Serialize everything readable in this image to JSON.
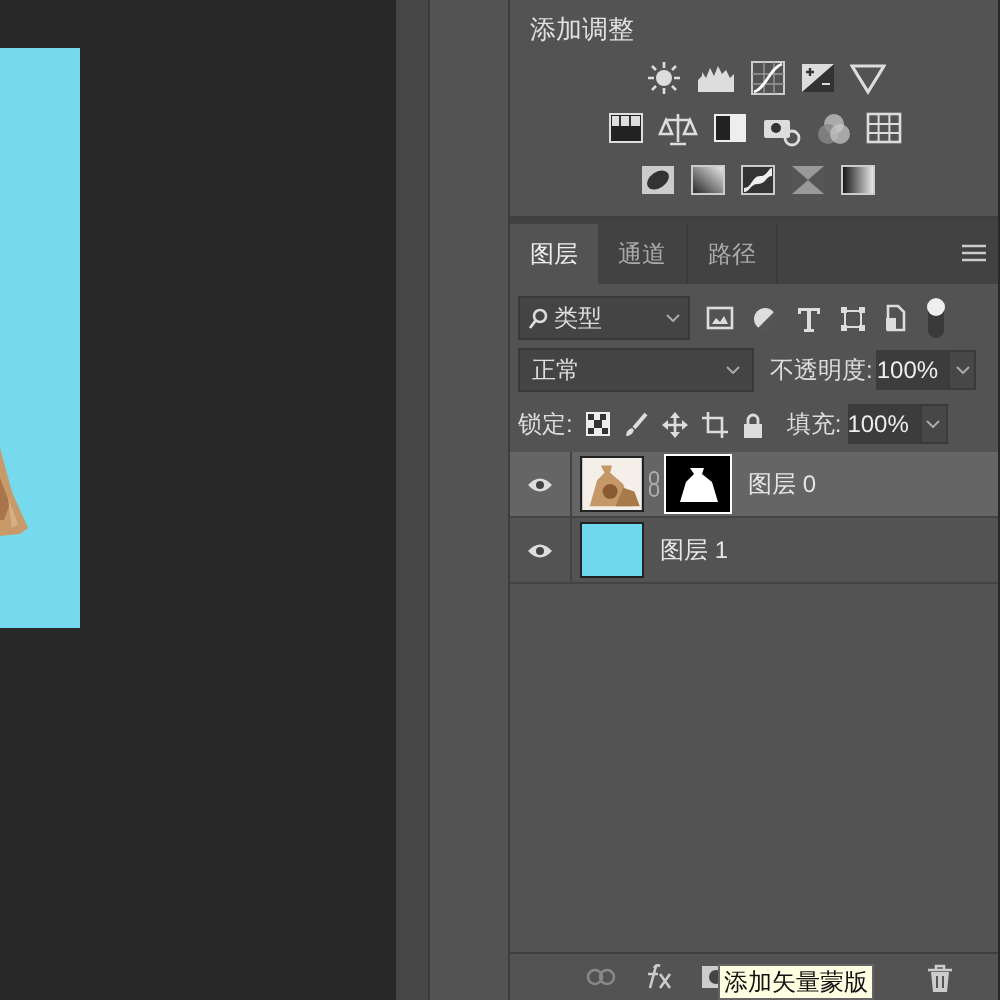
{
  "adjustments": {
    "title": "添加调整"
  },
  "layers_panel": {
    "tabs": [
      {
        "label": "图层",
        "selected": true
      },
      {
        "label": "通道",
        "selected": false
      },
      {
        "label": "路径",
        "selected": false
      }
    ],
    "filter": "类型",
    "blend_mode": "正常",
    "opacity_label": "不透明度:",
    "opacity": "100%",
    "lock_label": "锁定:",
    "fill_label": "填充:",
    "fill": "100%",
    "layers": [
      {
        "name": "图层",
        "index": "0",
        "kind": "masked_image",
        "visible": true,
        "selected": true
      },
      {
        "name": "图层",
        "index": "1",
        "kind": "solid_fill",
        "visible": true,
        "selected": false
      }
    ],
    "tooltip": "添加矢量蒙版"
  }
}
